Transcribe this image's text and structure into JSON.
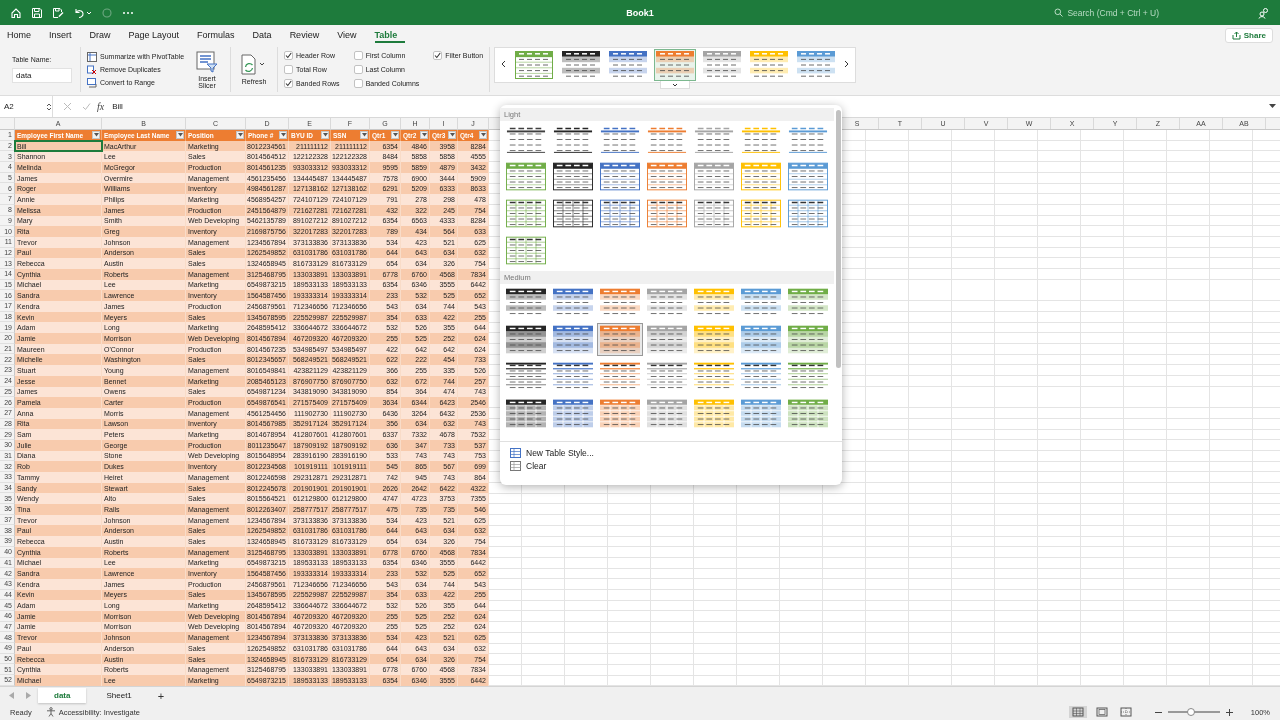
{
  "title_bar": {
    "title": "Book1",
    "search": {
      "placeholder": "Search (Cmd + Ctrl + U)"
    }
  },
  "ribbon_tabs": [
    {
      "label": "Home",
      "selected": false
    },
    {
      "label": "Insert",
      "selected": false
    },
    {
      "label": "Draw",
      "selected": false
    },
    {
      "label": "Page Layout",
      "selected": false
    },
    {
      "label": "Formulas",
      "selected": false
    },
    {
      "label": "Data",
      "selected": false
    },
    {
      "label": "Review",
      "selected": false
    },
    {
      "label": "View",
      "selected": false
    },
    {
      "label": "Table",
      "selected": true
    }
  ],
  "share_button": "Share",
  "ribbon": {
    "table_name": {
      "label": "Table Name:",
      "value": "data"
    },
    "tools": [
      "Summarize with PivotTable",
      "Remove Duplicates",
      "Convert to Range"
    ],
    "insert_slicer": "Insert Slicer",
    "refresh": "Refresh",
    "options": [
      {
        "label": "Header Row",
        "checked": true
      },
      {
        "label": "Total Row",
        "checked": false
      },
      {
        "label": "Banded Rows",
        "checked": true
      },
      {
        "label": "First Column",
        "checked": false
      },
      {
        "label": "Last Column",
        "checked": false
      },
      {
        "label": "Banded Columns",
        "checked": false
      },
      {
        "label": "Filter Button",
        "checked": true
      }
    ],
    "styles": [
      {
        "kind": "header",
        "color": "#70ad47",
        "selected": false
      },
      {
        "kind": "banded",
        "color": "#262626",
        "selected": false
      },
      {
        "kind": "banded",
        "color": "#4472c4",
        "selected": false
      },
      {
        "kind": "banded",
        "color": "#ed7d31",
        "selected": true
      },
      {
        "kind": "banded",
        "color": "#a5a5a5",
        "selected": false
      },
      {
        "kind": "banded",
        "color": "#ffc000",
        "selected": false
      },
      {
        "kind": "banded",
        "color": "#5b9bd5",
        "selected": false
      }
    ]
  },
  "formula_bar": {
    "name_box": "A2",
    "function_label": "fx",
    "value": "Bill"
  },
  "sheet": {
    "header_row_number": "1",
    "columns": [
      {
        "letter": "A",
        "header": "Employee First Name"
      },
      {
        "letter": "B",
        "header": "Employee Last Name"
      },
      {
        "letter": "C",
        "header": "Position"
      },
      {
        "letter": "D",
        "header": "Phone #"
      },
      {
        "letter": "E",
        "header": "BYU ID"
      },
      {
        "letter": "F",
        "header": "SSN"
      },
      {
        "letter": "G",
        "header": "Qtr1"
      },
      {
        "letter": "H",
        "header": "Qtr2"
      },
      {
        "letter": "I",
        "header": "Qtr3"
      },
      {
        "letter": "J",
        "header": "Qtr4"
      }
    ],
    "more_column_letters": [
      "S",
      "T",
      "U",
      "V",
      "W",
      "X",
      "Y",
      "Z",
      "AA",
      "AB"
    ],
    "rows": [
      {
        "number": "2",
        "cells": [
          "Bill",
          "MacArthur",
          "Marketing",
          "8012234561",
          "211111112",
          "211111112",
          "6354",
          "4846",
          "3958",
          "8284"
        ]
      },
      {
        "number": "3",
        "cells": [
          "Shannon",
          "Lee",
          "Sales",
          "8014564512",
          "122122328",
          "122122328",
          "8484",
          "5858",
          "5858",
          "4555"
        ]
      },
      {
        "number": "4",
        "cells": [
          "Melinda",
          "McGregor",
          "Production",
          "8014561235",
          "933033312",
          "933033312",
          "9595",
          "5859",
          "4879",
          "3432"
        ]
      },
      {
        "number": "5",
        "cells": [
          "James",
          "Overmire",
          "Management",
          "4561235456",
          "134445487",
          "134445487",
          "7578",
          "6900",
          "3444",
          "5909"
        ]
      },
      {
        "number": "6",
        "cells": [
          "Roger",
          "Williams",
          "Inventory",
          "4984561287",
          "127138162",
          "127138162",
          "6291",
          "5209",
          "6333",
          "8633"
        ]
      },
      {
        "number": "7",
        "cells": [
          "Annie",
          "Philips",
          "Marketing",
          "4568954257",
          "724107129",
          "724107129",
          "791",
          "278",
          "298",
          "478"
        ]
      },
      {
        "number": "8",
        "cells": [
          "Melissa",
          "James",
          "Production",
          "2451564879",
          "721627281",
          "721627281",
          "432",
          "322",
          "245",
          "754"
        ]
      },
      {
        "number": "9",
        "cells": [
          "Mary",
          "Smith",
          "Web Developing",
          "5462135789",
          "891027212",
          "891027212",
          "6354",
          "6563",
          "4333",
          "8284"
        ]
      },
      {
        "number": "10",
        "cells": [
          "Rita",
          "Greg",
          "Inventory",
          "2169875756",
          "322017283",
          "322017283",
          "789",
          "434",
          "564",
          "633"
        ]
      },
      {
        "number": "11",
        "cells": [
          "Trevor",
          "Johnson",
          "Management",
          "1234567894",
          "373133836",
          "373133836",
          "534",
          "423",
          "521",
          "625"
        ]
      },
      {
        "number": "12",
        "cells": [
          "Paul",
          "Anderson",
          "Sales",
          "1262549852",
          "631031786",
          "631031786",
          "644",
          "643",
          "634",
          "632"
        ]
      },
      {
        "number": "13",
        "cells": [
          "Rebecca",
          "Austin",
          "Sales",
          "1324658945",
          "816733129",
          "816733129",
          "654",
          "634",
          "326",
          "754"
        ]
      },
      {
        "number": "14",
        "cells": [
          "Cynthia",
          "Roberts",
          "Management",
          "3125468795",
          "133033891",
          "133033891",
          "6778",
          "6760",
          "4568",
          "7834"
        ]
      },
      {
        "number": "15",
        "cells": [
          "Michael",
          "Lee",
          "Marketing",
          "6549873215",
          "189533133",
          "189533133",
          "6354",
          "6346",
          "3555",
          "6442"
        ]
      },
      {
        "number": "16",
        "cells": [
          "Sandra",
          "Lawrence",
          "Inventory",
          "1564587456",
          "193333314",
          "193333314",
          "233",
          "532",
          "525",
          "652"
        ]
      },
      {
        "number": "17",
        "cells": [
          "Kendra",
          "James",
          "Production",
          "2456879561",
          "712346656",
          "712346656",
          "543",
          "634",
          "744",
          "543"
        ]
      },
      {
        "number": "18",
        "cells": [
          "Kevin",
          "Meyers",
          "Sales",
          "1345678595",
          "225529987",
          "225529987",
          "354",
          "633",
          "422",
          "255"
        ]
      },
      {
        "number": "19",
        "cells": [
          "Adam",
          "Long",
          "Marketing",
          "2648595412",
          "336644672",
          "336644672",
          "532",
          "526",
          "355",
          "644"
        ]
      },
      {
        "number": "20",
        "cells": [
          "Jamie",
          "Morrison",
          "Web Developing",
          "8014567894",
          "467209320",
          "467209320",
          "255",
          "525",
          "252",
          "624"
        ]
      },
      {
        "number": "21",
        "cells": [
          "Maureen",
          "O'Connor",
          "Production",
          "8014567235",
          "534985497",
          "534985497",
          "422",
          "642",
          "642",
          "624"
        ]
      },
      {
        "number": "22",
        "cells": [
          "Michelle",
          "Washington",
          "Sales",
          "8012345657",
          "568249521",
          "568249521",
          "622",
          "222",
          "454",
          "733"
        ]
      },
      {
        "number": "23",
        "cells": [
          "Stuart",
          "Young",
          "Management",
          "8016549841",
          "423821129",
          "423821129",
          "366",
          "255",
          "335",
          "526"
        ]
      },
      {
        "number": "24",
        "cells": [
          "Jesse",
          "Bennet",
          "Marketing",
          "2085465123",
          "876907750",
          "876907750",
          "632",
          "672",
          "744",
          "257"
        ]
      },
      {
        "number": "25",
        "cells": [
          "James",
          "Owens",
          "Sales",
          "6549871234",
          "343819090",
          "343819090",
          "854",
          "364",
          "474",
          "743"
        ]
      },
      {
        "number": "26",
        "cells": [
          "Pamela",
          "Carter",
          "Production",
          "6549876541",
          "271575409",
          "271575409",
          "3634",
          "6344",
          "6423",
          "2546"
        ]
      },
      {
        "number": "27",
        "cells": [
          "Anna",
          "Morris",
          "Management",
          "4561254456",
          "111902730",
          "111902730",
          "6436",
          "3264",
          "6432",
          "2536"
        ]
      },
      {
        "number": "28",
        "cells": [
          "Rita",
          "Lawson",
          "Inventory",
          "8014567985",
          "352917124",
          "352917124",
          "356",
          "634",
          "632",
          "743"
        ]
      },
      {
        "number": "29",
        "cells": [
          "Sam",
          "Peters",
          "Marketing",
          "8014678954",
          "412807601",
          "412807601",
          "6337",
          "7332",
          "4678",
          "7532"
        ]
      },
      {
        "number": "30",
        "cells": [
          "Julie",
          "George",
          "Production",
          "8011235647",
          "187909192",
          "187909192",
          "636",
          "347",
          "733",
          "537"
        ]
      },
      {
        "number": "31",
        "cells": [
          "Diana",
          "Stone",
          "Web Developing",
          "8015648954",
          "283916190",
          "283916190",
          "533",
          "743",
          "743",
          "753"
        ]
      },
      {
        "number": "32",
        "cells": [
          "Rob",
          "Dukes",
          "Inventory",
          "8012234568",
          "101919111",
          "101919111",
          "545",
          "865",
          "567",
          "699"
        ]
      },
      {
        "number": "33",
        "cells": [
          "Tammy",
          "Heiret",
          "Management",
          "8012246598",
          "292312871",
          "292312871",
          "742",
          "945",
          "743",
          "864"
        ]
      },
      {
        "number": "34",
        "cells": [
          "Sandy",
          "Stewart",
          "Sales",
          "8012245678",
          "201901901",
          "201901901",
          "2626",
          "2642",
          "6422",
          "4322"
        ]
      },
      {
        "number": "35",
        "cells": [
          "Wendy",
          "Alto",
          "Sales",
          "8015564521",
          "612129800",
          "612129800",
          "4747",
          "4723",
          "3753",
          "7355"
        ]
      },
      {
        "number": "36",
        "cells": [
          "Tina",
          "Ralls",
          "Management",
          "8012263407",
          "258777517",
          "258777517",
          "475",
          "735",
          "735",
          "546"
        ]
      },
      {
        "number": "37",
        "cells": [
          "Trevor",
          "Johnson",
          "Management",
          "1234567894",
          "373133836",
          "373133836",
          "534",
          "423",
          "521",
          "625"
        ]
      },
      {
        "number": "38",
        "cells": [
          "Paul",
          "Anderson",
          "Sales",
          "1262549852",
          "631031786",
          "631031786",
          "644",
          "643",
          "634",
          "632"
        ]
      },
      {
        "number": "39",
        "cells": [
          "Rebecca",
          "Austin",
          "Sales",
          "1324658945",
          "816733129",
          "816733129",
          "654",
          "634",
          "326",
          "754"
        ]
      },
      {
        "number": "40",
        "cells": [
          "Cynthia",
          "Roberts",
          "Management",
          "3125468795",
          "133033891",
          "133033891",
          "6778",
          "6760",
          "4568",
          "7834"
        ]
      },
      {
        "number": "41",
        "cells": [
          "Michael",
          "Lee",
          "Marketing",
          "6549873215",
          "189533133",
          "189533133",
          "6354",
          "6346",
          "3555",
          "6442"
        ]
      },
      {
        "number": "42",
        "cells": [
          "Sandra",
          "Lawrence",
          "Inventory",
          "1564587456",
          "193333314",
          "193333314",
          "233",
          "532",
          "525",
          "652"
        ]
      },
      {
        "number": "43",
        "cells": [
          "Kendra",
          "James",
          "Production",
          "2456879561",
          "712346656",
          "712346656",
          "543",
          "634",
          "744",
          "543"
        ]
      },
      {
        "number": "44",
        "cells": [
          "Kevin",
          "Meyers",
          "Sales",
          "1345678595",
          "225529987",
          "225529987",
          "354",
          "633",
          "422",
          "255"
        ]
      },
      {
        "number": "45",
        "cells": [
          "Adam",
          "Long",
          "Marketing",
          "2648595412",
          "336644672",
          "336644672",
          "532",
          "526",
          "355",
          "644"
        ]
      },
      {
        "number": "46",
        "cells": [
          "Jamie",
          "Morrison",
          "Web Developing",
          "8014567894",
          "467209320",
          "467209320",
          "255",
          "525",
          "252",
          "624"
        ]
      },
      {
        "number": "47",
        "cells": [
          "Jamie",
          "Morrison",
          "Web Developing",
          "8014567894",
          "467209320",
          "467209320",
          "255",
          "525",
          "252",
          "624"
        ]
      },
      {
        "number": "48",
        "cells": [
          "Trevor",
          "Johnson",
          "Management",
          "1234567894",
          "373133836",
          "373133836",
          "534",
          "423",
          "521",
          "625"
        ]
      },
      {
        "number": "49",
        "cells": [
          "Paul",
          "Anderson",
          "Sales",
          "1262549852",
          "631031786",
          "631031786",
          "644",
          "643",
          "634",
          "632"
        ]
      },
      {
        "number": "50",
        "cells": [
          "Rebecca",
          "Austin",
          "Sales",
          "1324658945",
          "816733129",
          "816733129",
          "654",
          "634",
          "326",
          "754"
        ]
      },
      {
        "number": "51",
        "cells": [
          "Cynthia",
          "Roberts",
          "Management",
          "3125468795",
          "133033891",
          "133033891",
          "6778",
          "6760",
          "4568",
          "7834"
        ]
      },
      {
        "number": "52",
        "cells": [
          "Michael",
          "Lee",
          "Marketing",
          "6549873215",
          "189533133",
          "189533133",
          "6354",
          "6346",
          "3555",
          "6442"
        ]
      }
    ]
  },
  "style_panel": {
    "sections": [
      {
        "title": "Light",
        "styles": [
          {
            "kind": "plain",
            "color": "#404040",
            "selected": false
          },
          {
            "kind": "plain",
            "color": "#262626",
            "selected": false
          },
          {
            "kind": "plain",
            "color": "#4472c4",
            "selected": false
          },
          {
            "kind": "plain",
            "color": "#ed7d31",
            "selected": false
          },
          {
            "kind": "plain",
            "color": "#a5a5a5",
            "selected": false
          },
          {
            "kind": "plain",
            "color": "#ffc000",
            "selected": false
          },
          {
            "kind": "plain",
            "color": "#5b9bd5",
            "selected": false
          },
          {
            "kind": "header",
            "color": "#70ad47",
            "selected": false
          },
          {
            "kind": "header",
            "color": "#262626",
            "selected": false
          },
          {
            "kind": "header",
            "color": "#4472c4",
            "selected": false
          },
          {
            "kind": "header",
            "color": "#ed7d31",
            "selected": false
          },
          {
            "kind": "header",
            "color": "#a5a5a5",
            "selected": false
          },
          {
            "kind": "header",
            "color": "#ffc000",
            "selected": false
          },
          {
            "kind": "header",
            "color": "#5b9bd5",
            "selected": false
          },
          {
            "kind": "grid",
            "color": "#70ad47",
            "selected": false
          },
          {
            "kind": "grid",
            "color": "#262626",
            "selected": false
          },
          {
            "kind": "grid",
            "color": "#4472c4",
            "selected": false
          },
          {
            "kind": "grid",
            "color": "#ed7d31",
            "selected": false
          },
          {
            "kind": "grid",
            "color": "#a5a5a5",
            "selected": false
          },
          {
            "kind": "grid",
            "color": "#ffc000",
            "selected": false
          },
          {
            "kind": "grid",
            "color": "#5b9bd5",
            "selected": false
          },
          {
            "kind": "grid",
            "color": "#70ad47",
            "selected": false
          }
        ]
      },
      {
        "title": "Medium",
        "styles": [
          {
            "kind": "banded",
            "color": "#262626",
            "selected": false
          },
          {
            "kind": "banded",
            "color": "#4472c4",
            "selected": false
          },
          {
            "kind": "banded",
            "color": "#ed7d31",
            "selected": false
          },
          {
            "kind": "banded",
            "color": "#a5a5a5",
            "selected": false
          },
          {
            "kind": "banded",
            "color": "#ffc000",
            "selected": false
          },
          {
            "kind": "banded",
            "color": "#5b9bd5",
            "selected": false
          },
          {
            "kind": "banded",
            "color": "#70ad47",
            "selected": false
          },
          {
            "kind": "filled",
            "color": "#262626",
            "selected": false
          },
          {
            "kind": "filled",
            "color": "#4472c4",
            "selected": false
          },
          {
            "kind": "filled",
            "color": "#ed7d31",
            "selected": true
          },
          {
            "kind": "filled",
            "color": "#a5a5a5",
            "selected": false
          },
          {
            "kind": "filled",
            "color": "#ffc000",
            "selected": false
          },
          {
            "kind": "filled",
            "color": "#5b9bd5",
            "selected": false
          },
          {
            "kind": "filled",
            "color": "#70ad47",
            "selected": false
          },
          {
            "kind": "striped",
            "color": "#262626",
            "selected": false
          },
          {
            "kind": "striped",
            "color": "#4472c4",
            "selected": false
          },
          {
            "kind": "striped",
            "color": "#ed7d31",
            "selected": false
          },
          {
            "kind": "striped",
            "color": "#a5a5a5",
            "selected": false
          },
          {
            "kind": "striped",
            "color": "#ffc000",
            "selected": false
          },
          {
            "kind": "striped",
            "color": "#5b9bd5",
            "selected": false
          },
          {
            "kind": "striped",
            "color": "#70ad47",
            "selected": false
          },
          {
            "kind": "blocks",
            "color": "#262626",
            "selected": false
          },
          {
            "kind": "blocks",
            "color": "#4472c4",
            "selected": false
          },
          {
            "kind": "blocks",
            "color": "#ed7d31",
            "selected": false
          },
          {
            "kind": "blocks",
            "color": "#a5a5a5",
            "selected": false
          },
          {
            "kind": "blocks",
            "color": "#ffc000",
            "selected": false
          },
          {
            "kind": "blocks",
            "color": "#5b9bd5",
            "selected": false
          },
          {
            "kind": "blocks",
            "color": "#70ad47",
            "selected": false
          }
        ]
      }
    ],
    "actions": [
      "New Table Style...",
      "Clear"
    ]
  },
  "sheet_tabs": [
    {
      "label": "data",
      "selected": true
    },
    {
      "label": "Sheet1",
      "selected": false
    }
  ],
  "add_sheet": "+",
  "status_bar": {
    "status": "Ready",
    "accessibility": "Accessibility: Investigate",
    "views": [
      {
        "kind": "normal",
        "selected": true
      },
      {
        "kind": "page-layout",
        "selected": false
      },
      {
        "kind": "page-break",
        "selected": false
      }
    ],
    "zoom": {
      "level": 0.45,
      "reading": "100%"
    }
  }
}
